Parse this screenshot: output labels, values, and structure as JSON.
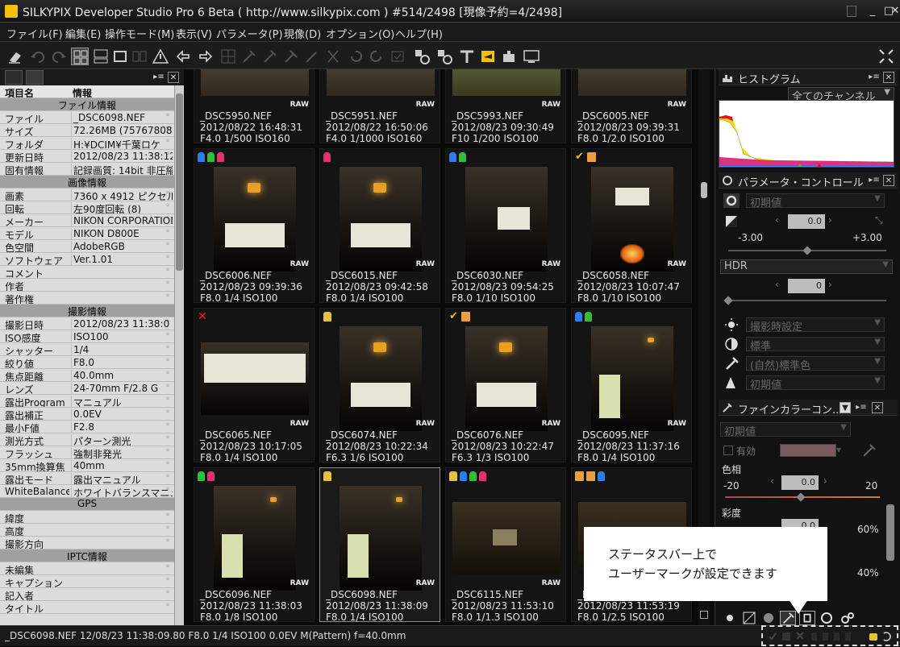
{
  "window": {
    "title": "SILKYPIX Developer Studio Pro 6 Beta ( http://www.silkypix.com )   #514/2498 [現像予約=4/2498]"
  },
  "menu": [
    "ファイル(F)",
    "編集(E)",
    "操作モード(M)",
    "表示(V)",
    "パラメータ(P)",
    "現像(D)",
    "オプション(O)",
    "ヘルプ(H)"
  ],
  "info_panel": {
    "col_item": "項目名",
    "col_info": "情報",
    "sections": [
      {
        "title": "ファイル情報",
        "rows": [
          {
            "k": "ファイル",
            "v": "_DSC6098.NEF"
          },
          {
            "k": "サイズ",
            "v": "72.26MB (75767808B"
          },
          {
            "k": "フォルダ",
            "v": "H:¥DCIM¥千葉ロケ"
          },
          {
            "k": "更新日時",
            "v": "2012/08/23 11:38:12"
          },
          {
            "k": "固有情報",
            "v": "記録画質: 14bit 非圧縮"
          }
        ]
      },
      {
        "title": "画像情報",
        "rows": [
          {
            "k": "画素",
            "v": "7360 x 4912 ピクセル"
          },
          {
            "k": "回転",
            "v": "左90度回転 (8)"
          },
          {
            "k": "メーカー",
            "v": "NIKON CORPORATION"
          },
          {
            "k": "モデル",
            "v": "NIKON D800E"
          },
          {
            "k": "色空間",
            "v": "AdobeRGB"
          },
          {
            "k": "ソフトウェア",
            "v": "Ver.1.01"
          },
          {
            "k": "コメント",
            "v": ""
          },
          {
            "k": "作者",
            "v": ""
          },
          {
            "k": "著作権",
            "v": ""
          }
        ]
      },
      {
        "title": "撮影情報",
        "rows": [
          {
            "k": "撮影日時",
            "v": "2012/08/23 11:38:0"
          },
          {
            "k": "ISO感度",
            "v": "ISO100"
          },
          {
            "k": "シャッター",
            "v": "1/4"
          },
          {
            "k": "絞り値",
            "v": "F8.0"
          },
          {
            "k": "焦点距離",
            "v": "40.0mm"
          },
          {
            "k": "レンズ",
            "v": "24-70mm F/2.8 G"
          },
          {
            "k": "露出Program",
            "v": "マニュアル"
          },
          {
            "k": "露出補正",
            "v": "0.0EV"
          },
          {
            "k": "最小F値",
            "v": "F2.8"
          },
          {
            "k": "測光方式",
            "v": "パターン測光"
          },
          {
            "k": "フラッシュ",
            "v": "強制非発光"
          },
          {
            "k": "35mm換算焦",
            "v": "40mm"
          },
          {
            "k": "露出モード",
            "v": "露出マニュアル"
          },
          {
            "k": "WhiteBalance",
            "v": "ホワイトバランスマニュ"
          }
        ]
      },
      {
        "title": "GPS",
        "rows": [
          {
            "k": "緯度",
            "v": ""
          },
          {
            "k": "高度",
            "v": ""
          },
          {
            "k": "撮影方向",
            "v": ""
          }
        ]
      },
      {
        "title": "IPTC情報",
        "rows": [
          {
            "k": "未編集",
            "v": ""
          },
          {
            "k": "キャプション",
            "v": ""
          },
          {
            "k": "記入者",
            "v": ""
          },
          {
            "k": "タイトル",
            "v": ""
          }
        ]
      }
    ]
  },
  "thumbnails": [
    {
      "name": "_DSC5950.NEF",
      "date": "2012/08/22 16:48:31",
      "exif": "F4.0  1/500   ISO160",
      "marks": [],
      "style": "top"
    },
    {
      "name": "_DSC5951.NEF",
      "date": "2012/08/22 16:50:06",
      "exif": "F4.0  1/1000  ISO160",
      "marks": [],
      "style": "top"
    },
    {
      "name": "_DSC5993.NEF",
      "date": "2012/08/23 09:30:49",
      "exif": "F10   1/200   ISO100",
      "marks": [],
      "style": "top"
    },
    {
      "name": "_DSC6005.NEF",
      "date": "2012/08/23 09:39:31",
      "exif": "F8.0  1/2.0   ISO100",
      "marks": [],
      "style": "top"
    },
    {
      "name": "_DSC6006.NEF",
      "date": "2012/08/23 09:39:36",
      "exif": "F8.0  1/4    ISO100",
      "marks": [
        "blue",
        "green",
        "pink"
      ],
      "style": "lamp"
    },
    {
      "name": "_DSC6015.NEF",
      "date": "2012/08/23 09:42:58",
      "exif": "F8.0  1/4    ISO100",
      "marks": [
        "pink"
      ],
      "style": "lamp"
    },
    {
      "name": "_DSC6030.NEF",
      "date": "2012/08/23 09:54:25",
      "exif": "F8.0  1/10   ISO100",
      "marks": [
        "blue",
        "green"
      ],
      "style": "dark"
    },
    {
      "name": "_DSC6058.NEF",
      "date": "2012/08/23 10:07:47",
      "exif": "F8.0  1/10   ISO100",
      "marks": [
        "check",
        "doc"
      ],
      "style": "fire"
    },
    {
      "name": "_DSC6065.NEF",
      "date": "2012/08/23 10:17:05",
      "exif": "F8.0  1/4    ISO100",
      "marks": [
        "x"
      ],
      "style": "land"
    },
    {
      "name": "_DSC6074.NEF",
      "date": "2012/08/23 10:22:34",
      "exif": "F6.3  1/6    ISO100",
      "marks": [
        "lock"
      ],
      "style": "lamp"
    },
    {
      "name": "_DSC6076.NEF",
      "date": "2012/08/23 10:22:47",
      "exif": "F6.3  1/3    ISO100",
      "marks": [
        "check",
        "doc"
      ],
      "style": "lamp"
    },
    {
      "name": "_DSC6095.NEF",
      "date": "2012/08/23 11:37:16",
      "exif": "F8.0  1/4    ISO100",
      "marks": [
        "blue",
        "green"
      ],
      "style": "door"
    },
    {
      "name": "_DSC6096.NEF",
      "date": "2012/08/23 11:38:03",
      "exif": "F8.0  1/8    ISO100",
      "marks": [
        "green",
        "pink"
      ],
      "style": "door"
    },
    {
      "name": "_DSC6098.NEF",
      "date": "2012/08/23 11:38:09",
      "exif": "F8.0  1/4    ISO100",
      "marks": [
        "lock"
      ],
      "style": "door",
      "selected": true
    },
    {
      "name": "_DSC6115.NEF",
      "date": "2012/08/23 11:53:10",
      "exif": "F8.0  1/1.3  ISO100",
      "marks": [
        "lock",
        "blue",
        "green",
        "pink"
      ],
      "style": "land2"
    },
    {
      "name": "_DSC6",
      "date": "2012/08/23 11:53:19",
      "exif": "F8.0  1/2.5  ISO100",
      "marks": [
        "doc",
        "doc",
        "blue"
      ],
      "style": "land2"
    }
  ],
  "raw_label": "RAW",
  "histogram": {
    "title": "ヒストグラム",
    "channel": "全てのチャンネル"
  },
  "param_control": {
    "title": "パラメータ・コントロール",
    "preset": "初期値",
    "exposure_value": "0.0",
    "min": "-3.00",
    "max": "+3.00",
    "hdr_label": "HDR",
    "hdr_value": "0",
    "wb": "撮影時設定",
    "contrast": "標準",
    "color": "(自然)標準色",
    "sharp": "初期値"
  },
  "fine_color": {
    "title": "ファインカラーコン...",
    "preset": "初期値",
    "enable_label": "有効",
    "hue_label": "色相",
    "hue_min": "-20",
    "hue_value": "0.0",
    "hue_max": "20",
    "sat_label": "彩度",
    "sat_min_partial": "-60%",
    "sat_value": "0.0",
    "sat_max": "60%",
    "light_max": "40%",
    "swatch_color": "#7a5a60"
  },
  "status": {
    "text": "_DSC6098.NEF 12/08/23 11:38:09.80 F8.0  1/4    ISO100  0.0EV M(Pattern) f=40.0mm"
  },
  "callout": {
    "line1": "ステータスバー上で",
    "line2": "ユーザーマークが設定できます"
  }
}
